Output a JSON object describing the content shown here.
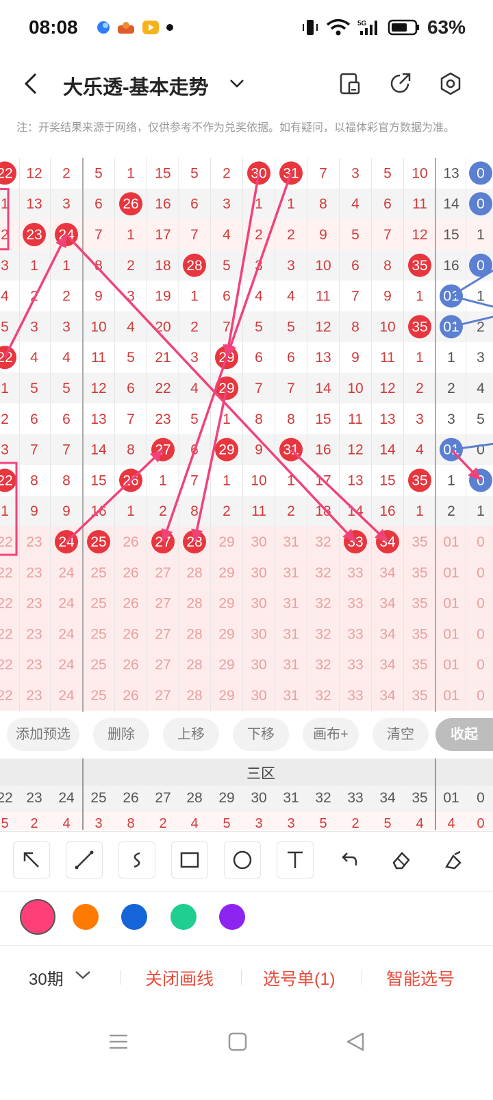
{
  "status": {
    "time": "08:08",
    "battery": "63%",
    "network": "5G"
  },
  "header": {
    "title": "大乐透-基本走势"
  },
  "note": "注：开奖结果来源于网络，仅供参考不作为兑奖依据。如有疑问，以福体彩官方数据为准。",
  "grid": {
    "rows": [
      {
        "type": "draw",
        "cells": [
          "22",
          "12",
          "2",
          "5",
          "1",
          "15",
          "5",
          "2",
          "30",
          "31",
          "7",
          "3",
          "5",
          "10",
          "13",
          "0"
        ],
        "hits": [
          0,
          8,
          9
        ],
        "blue": [
          15
        ]
      },
      {
        "type": "draw",
        "cells": [
          "1",
          "13",
          "3",
          "6",
          "26",
          "16",
          "6",
          "3",
          "1",
          "1",
          "8",
          "4",
          "6",
          "11",
          "14",
          "0"
        ],
        "hits": [
          4
        ],
        "blue": [
          15
        ]
      },
      {
        "type": "draw",
        "cells": [
          "2",
          "23",
          "24",
          "7",
          "1",
          "17",
          "7",
          "4",
          "2",
          "2",
          "9",
          "5",
          "7",
          "12",
          "15",
          "1"
        ],
        "hits": [
          1,
          2
        ],
        "blue": []
      },
      {
        "type": "draw",
        "cells": [
          "3",
          "1",
          "1",
          "8",
          "2",
          "18",
          "28",
          "5",
          "3",
          "3",
          "10",
          "6",
          "8",
          "35",
          "16",
          "0"
        ],
        "hits": [
          6,
          13
        ],
        "blue": [
          15
        ]
      },
      {
        "type": "draw",
        "cells": [
          "4",
          "2",
          "2",
          "9",
          "3",
          "19",
          "1",
          "6",
          "4",
          "4",
          "11",
          "7",
          "9",
          "1",
          "01",
          "1"
        ],
        "hits": [],
        "blue": [
          14
        ]
      },
      {
        "type": "draw",
        "cells": [
          "5",
          "3",
          "3",
          "10",
          "4",
          "20",
          "2",
          "7",
          "5",
          "5",
          "12",
          "8",
          "10",
          "35",
          "01",
          "2"
        ],
        "hits": [
          13
        ],
        "blue": [
          14
        ]
      },
      {
        "type": "draw",
        "cells": [
          "22",
          "4",
          "4",
          "11",
          "5",
          "21",
          "3",
          "29",
          "6",
          "6",
          "13",
          "9",
          "11",
          "1",
          "1",
          "3"
        ],
        "hits": [
          0,
          7
        ],
        "blue": []
      },
      {
        "type": "draw",
        "cells": [
          "1",
          "5",
          "5",
          "12",
          "6",
          "22",
          "4",
          "29",
          "7",
          "7",
          "14",
          "10",
          "12",
          "2",
          "2",
          "4"
        ],
        "hits": [
          7
        ],
        "blue": []
      },
      {
        "type": "draw",
        "cells": [
          "2",
          "6",
          "6",
          "13",
          "7",
          "23",
          "5",
          "1",
          "8",
          "8",
          "15",
          "11",
          "13",
          "3",
          "3",
          "5"
        ],
        "hits": [],
        "blue": []
      },
      {
        "type": "draw",
        "cells": [
          "3",
          "7",
          "7",
          "14",
          "8",
          "27",
          "6",
          "29",
          "9",
          "31",
          "16",
          "12",
          "14",
          "4",
          "01",
          "0"
        ],
        "hits": [
          5,
          7,
          9
        ],
        "blue": [
          14
        ]
      },
      {
        "type": "draw",
        "cells": [
          "22",
          "8",
          "8",
          "15",
          "26",
          "1",
          "7",
          "1",
          "10",
          "1",
          "17",
          "13",
          "15",
          "35",
          "1",
          "0"
        ],
        "hits": [
          0,
          4,
          13
        ],
        "blue": [
          15
        ]
      },
      {
        "type": "draw",
        "cells": [
          "1",
          "9",
          "9",
          "16",
          "1",
          "2",
          "8",
          "2",
          "11",
          "2",
          "18",
          "14",
          "16",
          "1",
          "2",
          "1"
        ],
        "hits": [],
        "blue": []
      },
      {
        "type": "pick",
        "cells": [
          "22",
          "23",
          "24",
          "25",
          "26",
          "27",
          "28",
          "29",
          "30",
          "31",
          "32",
          "33",
          "34",
          "35",
          "01",
          "0"
        ],
        "hits": [
          2,
          3,
          5,
          6,
          11,
          12
        ],
        "blue": []
      },
      {
        "type": "pick",
        "cells": [
          "22",
          "23",
          "24",
          "25",
          "26",
          "27",
          "28",
          "29",
          "30",
          "31",
          "32",
          "33",
          "34",
          "35",
          "01",
          "0"
        ],
        "hits": [],
        "blue": []
      },
      {
        "type": "pick",
        "cells": [
          "22",
          "23",
          "24",
          "25",
          "26",
          "27",
          "28",
          "29",
          "30",
          "31",
          "32",
          "33",
          "34",
          "35",
          "01",
          "0"
        ],
        "hits": [],
        "blue": []
      },
      {
        "type": "pick",
        "cells": [
          "22",
          "23",
          "24",
          "25",
          "26",
          "27",
          "28",
          "29",
          "30",
          "31",
          "32",
          "33",
          "34",
          "35",
          "01",
          "0"
        ],
        "hits": [],
        "blue": []
      },
      {
        "type": "pick",
        "cells": [
          "22",
          "23",
          "24",
          "25",
          "26",
          "27",
          "28",
          "29",
          "30",
          "31",
          "32",
          "33",
          "34",
          "35",
          "01",
          "0"
        ],
        "hits": [],
        "blue": []
      },
      {
        "type": "pick",
        "cells": [
          "22",
          "23",
          "24",
          "25",
          "26",
          "27",
          "28",
          "29",
          "30",
          "31",
          "32",
          "33",
          "34",
          "35",
          "01",
          "0"
        ],
        "hits": [],
        "blue": []
      }
    ]
  },
  "toolbar": {
    "buttons": [
      "添加预选",
      "删除",
      "上移",
      "下移",
      "画布+",
      "清空",
      "收起"
    ]
  },
  "section": {
    "label": "三区",
    "numbers": [
      "22",
      "23",
      "24",
      "25",
      "26",
      "27",
      "28",
      "29",
      "30",
      "31",
      "32",
      "33",
      "34",
      "35",
      "01",
      "0"
    ],
    "values": [
      "5",
      "2",
      "4",
      "3",
      "8",
      "2",
      "4",
      "5",
      "3",
      "3",
      "5",
      "2",
      "5",
      "4",
      "4",
      "0"
    ]
  },
  "draw_tools": [
    "arrow-tool",
    "line-tool",
    "curve-tool",
    "rectangle-tool",
    "circle-tool",
    "text-tool",
    "undo-tool",
    "eraser-tool",
    "clear-tool"
  ],
  "colors": [
    "#ff4078",
    "#ff7a00",
    "#1565d8",
    "#1fcf8f",
    "#8e24f0"
  ],
  "bottom": {
    "period": "30期",
    "close_draw": "关闭画线",
    "selection": "选号单(1)",
    "smart": "智能选号"
  },
  "theme": {
    "red": "#e8363f",
    "blue": "#5b7fd1",
    "pink": "#f0437a"
  }
}
